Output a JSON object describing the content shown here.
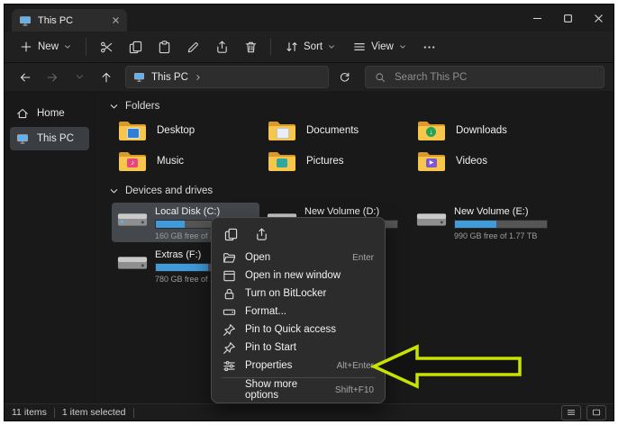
{
  "window": {
    "tab_title": "This PC"
  },
  "toolbar": {
    "new_label": "New",
    "sort_label": "Sort",
    "view_label": "View"
  },
  "navbar": {
    "address": "This PC",
    "search_placeholder": "Search This PC"
  },
  "sidebar": {
    "items": [
      {
        "label": "Home",
        "icon": "home-icon"
      },
      {
        "label": "This PC",
        "icon": "pc-monitor-icon",
        "selected": true
      }
    ]
  },
  "content": {
    "folders_header": "Folders",
    "folders": [
      {
        "name": "Desktop"
      },
      {
        "name": "Documents"
      },
      {
        "name": "Downloads"
      },
      {
        "name": "Music"
      },
      {
        "name": "Pictures"
      },
      {
        "name": "Videos"
      }
    ],
    "drives_header": "Devices and drives",
    "drives": [
      {
        "name": "Local Disk (C:)",
        "free": "160 GB free of 232 GB",
        "usage_percent": 31,
        "selected": true
      },
      {
        "name": "New Volume (D:)",
        "free": "",
        "usage_percent": 40,
        "selected": false
      },
      {
        "name": "New Volume (E:)",
        "free": "990 GB free of 1.77 TB",
        "usage_percent": 45,
        "selected": false
      },
      {
        "name": "Extras (F:)",
        "free": "780 GB free of 1.81 TB",
        "usage_percent": 57,
        "selected": false
      }
    ]
  },
  "context_menu": {
    "icon_row": [
      "copy-icon",
      "share-icon"
    ],
    "items": [
      {
        "label": "Open",
        "shortcut": "Enter",
        "icon": "open-icon"
      },
      {
        "label": "Open in new window",
        "shortcut": "",
        "icon": "new-window-icon"
      },
      {
        "label": "Turn on BitLocker",
        "shortcut": "",
        "icon": "bitlocker-lock-icon"
      },
      {
        "label": "Format...",
        "shortcut": "",
        "icon": "format-drive-icon"
      },
      {
        "label": "Pin to Quick access",
        "shortcut": "",
        "icon": "pin-icon"
      },
      {
        "label": "Pin to Start",
        "shortcut": "",
        "icon": "pin-icon"
      },
      {
        "label": "Properties",
        "shortcut": "Alt+Enter",
        "icon": "properties-icon"
      },
      {
        "label": "Show more options",
        "shortcut": "Shift+F10",
        "icon": ""
      }
    ]
  },
  "statusbar": {
    "item_count": "11 items",
    "selection": "1 item selected"
  },
  "colors": {
    "drive_bar_blue": "#3f9bdc",
    "annotation_green": "#c9e300",
    "folder_yellow": "#f7c64a",
    "selection_gray": "#44484d"
  }
}
